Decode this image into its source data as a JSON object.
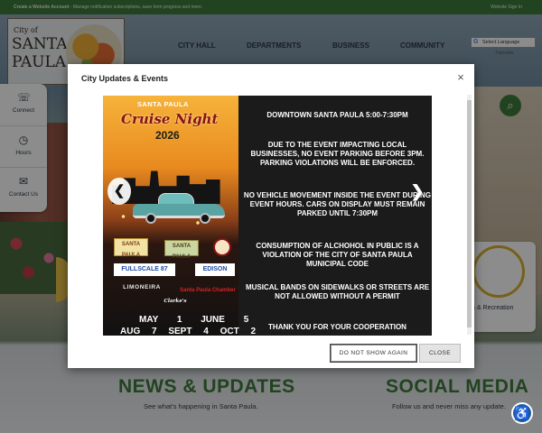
{
  "topbar": {
    "create_label": "Create a Website Account",
    "create_desc": " - Manage notification subscriptions, save form progress and more.",
    "signin_label": "Website Sign In"
  },
  "logo": {
    "city_of": "City of",
    "name": "SANTA PAULA"
  },
  "nav": {
    "items": [
      "CITY HALL",
      "DEPARTMENTS",
      "BUSINESS",
      "COMMUNITY"
    ]
  },
  "translate": {
    "select_label": "Select Language",
    "powered_by": "Translate"
  },
  "quick_links": [
    {
      "label": "Connect",
      "icon": "phone-card-icon"
    },
    {
      "label": "Hours",
      "icon": "clock-icon"
    },
    {
      "label": "Contact Us",
      "icon": "chat-icon"
    }
  ],
  "icon_card": {
    "label": "ks & Recreation",
    "icon": "bench-icon"
  },
  "sections": {
    "news_title": "NEWS & UPDATES",
    "news_sub": "See what's happening in Santa Paula.",
    "social_title": "SOCIAL MEDIA",
    "social_sub": "Follow us and never miss any update."
  },
  "modal": {
    "title": "City Updates & Events",
    "close_symbol": "×",
    "prev_symbol": "❮",
    "next_symbol": "❯",
    "dont_show_label": "DO NOT SHOW AGAIN",
    "close_label": "CLOSE",
    "flyer": {
      "event_title": "SANTA PAULA",
      "event_script": "Cruise Night",
      "event_year": "2026",
      "sponsors": [
        "SANTA PAULA",
        "SANTA PAULA",
        "",
        "FULLSCALE 87",
        "EDISON",
        "LIMONEIRA",
        "Santa Paula Chamber",
        "Clarke's"
      ],
      "dates_line1": "MAY 1 JUNE 5",
      "dates_line2": "AUG 7 SEPT 4 OCT 2",
      "notices": [
        "DOWNTOWN SANTA PAULA 5:00-7:30PM",
        "DUE TO THE EVENT IMPACTING LOCAL BUSINESSES, NO EVENT PARKING BEFORE 3PM. PARKING VIOLATIONS WILL BE ENFORCED.",
        "NO VEHICLE MOVEMENT INSIDE THE EVENT DURING EVENT HOURS. CARS ON DISPLAY MUST REMAIN PARKED UNTIL 7:30PM",
        "CONSUMPTION OF ALCHOHOL IN PUBLIC IS A VIOLATION OF THE CITY OF SANTA PAULA MUNICIPAL CODE",
        "MUSICAL BANDS ON SIDEWALKS OR STREETS ARE NOT ALLOWED WITHOUT A PERMIT",
        "THANK YOU FOR YOUR COOPERATION"
      ]
    }
  },
  "accessibility_icon": "accessibility-icon",
  "colors": {
    "brand_green": "#3e7a3b",
    "accent_gold": "#d9b02c",
    "access_blue": "#1d5c9b"
  }
}
